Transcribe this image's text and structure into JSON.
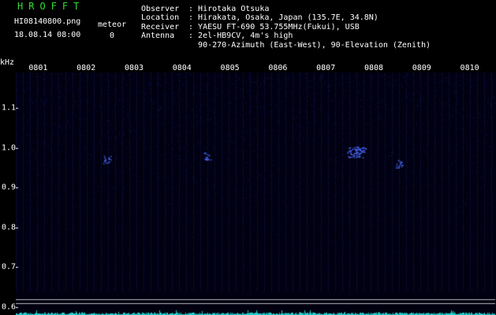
{
  "app": {
    "title": "HROFFT"
  },
  "file": {
    "name": "HI08140800.png",
    "timestamp": "18.08.14 08:00"
  },
  "meteor": {
    "label": "meteor",
    "count": "0"
  },
  "info": {
    "rows": [
      {
        "label": "Observer",
        "value": "Hirotaka Otsuka"
      },
      {
        "label": "Location",
        "value": "Hirakata, Osaka, Japan (135.7E, 34.8N)"
      },
      {
        "label": "Receiver",
        "value": "YAESU FT-690 53.755MHz(Fukui), USB"
      },
      {
        "label": "Antenna",
        "value": "2el-HB9CV, 4m's high"
      },
      {
        "label": "",
        "value": "90-270-Azimuth (East-West), 90-Elevation (Zenith)"
      }
    ]
  },
  "spectrogram": {
    "yunit": "kHz",
    "x_ticks": [
      "0801",
      "0802",
      "0803",
      "0804",
      "0805",
      "0806",
      "0807",
      "0808",
      "0809",
      "0810"
    ],
    "y_ticks": [
      "1.1",
      "1.0",
      "0.9",
      "0.8",
      "0.7",
      "0.6"
    ],
    "y_tick_values": [
      1.1,
      1.0,
      0.9,
      0.8,
      0.7,
      0.6
    ],
    "x_range_minutes": [
      0,
      10
    ],
    "y_range_khz": [
      0.58,
      1.19
    ],
    "reference_lines_khz": [
      0.62,
      0.61
    ],
    "echoes": [
      {
        "minute": 1.9,
        "khz": 0.97
      },
      {
        "minute": 4.0,
        "khz": 0.98
      },
      {
        "minute": 7.1,
        "khz": 0.99
      },
      {
        "minute": 8.0,
        "khz": 0.96
      }
    ],
    "colors": {
      "background": "#000010",
      "noise": "#1c1c66",
      "echo": "#4d6bff",
      "signal": "#22cccc",
      "grid": "#ffffff"
    }
  }
}
